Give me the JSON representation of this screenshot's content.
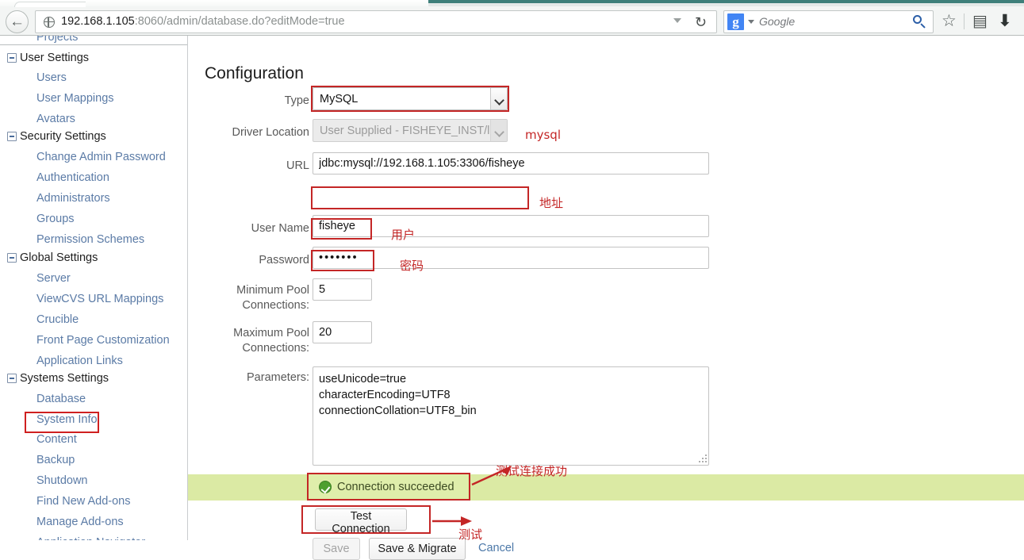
{
  "browser": {
    "url_host": "192.168.1.105",
    "url_rest": ":8060/admin/database.do?editMode=true",
    "back_glyph": "←",
    "reload_glyph": "↻",
    "search_engine_letter": "g",
    "search_placeholder": "Google",
    "star_glyph": "☆",
    "reader_glyph": "▤",
    "download_glyph": "⬇"
  },
  "sidebar": {
    "items": [
      {
        "label": "Projects",
        "type": "link-partial"
      },
      {
        "label": "User Settings",
        "type": "group"
      },
      {
        "label": "Users",
        "type": "link"
      },
      {
        "label": "User Mappings",
        "type": "link"
      },
      {
        "label": "Avatars",
        "type": "link"
      },
      {
        "label": "Security Settings",
        "type": "group"
      },
      {
        "label": "Change Admin Password",
        "type": "link"
      },
      {
        "label": "Authentication",
        "type": "link"
      },
      {
        "label": "Administrators",
        "type": "link"
      },
      {
        "label": "Groups",
        "type": "link"
      },
      {
        "label": "Permission Schemes",
        "type": "link"
      },
      {
        "label": "Global Settings",
        "type": "group"
      },
      {
        "label": "Server",
        "type": "link"
      },
      {
        "label": "ViewCVS URL Mappings",
        "type": "link"
      },
      {
        "label": "Crucible",
        "type": "link"
      },
      {
        "label": "Front Page Customization",
        "type": "link"
      },
      {
        "label": "Application Links",
        "type": "link"
      },
      {
        "label": "Systems Settings",
        "type": "group"
      },
      {
        "label": "Database",
        "type": "link",
        "highlighted": true
      },
      {
        "label": "System Info",
        "type": "link"
      },
      {
        "label": "Content",
        "type": "link"
      },
      {
        "label": "Backup",
        "type": "link"
      },
      {
        "label": "Shutdown",
        "type": "link"
      },
      {
        "label": "Find New Add-ons",
        "type": "link"
      },
      {
        "label": "Manage Add-ons",
        "type": "link"
      },
      {
        "label": "Application Navigator",
        "type": "link"
      }
    ]
  },
  "main": {
    "title": "Configuration",
    "fields": {
      "type": {
        "label": "Type",
        "value": "MySQL"
      },
      "driver_location": {
        "label": "Driver Location",
        "value": "User Supplied - FISHEYE_INST/lib",
        "disabled": true
      },
      "url": {
        "label": "URL",
        "value": "jdbc:mysql://192.168.1.105:3306/fisheye"
      },
      "user_name": {
        "label": "User Name",
        "value": "fisheye"
      },
      "password": {
        "label": "Password",
        "value": "•••••••"
      },
      "min_pool": {
        "label": "Minimum Pool Connections:",
        "value": "5"
      },
      "max_pool": {
        "label": "Maximum Pool Connections:",
        "value": "20"
      },
      "parameters": {
        "label": "Parameters:",
        "value": "useUnicode=true\ncharacterEncoding=UTF8\nconnectionCollation=UTF8_bin"
      }
    },
    "status": {
      "text": "Connection succeeded",
      "icon": "check-circle-icon",
      "color": "#dfeeab"
    },
    "buttons": {
      "test_connection": "Test Connection",
      "save": "Save",
      "save_migrate": "Save & Migrate",
      "cancel": "Cancel"
    }
  },
  "annotations": {
    "type": "mysql",
    "url": "地址",
    "user": "用户",
    "password": "密码",
    "status": "测试连接成功",
    "test": "测试",
    "color": "#c42626"
  }
}
